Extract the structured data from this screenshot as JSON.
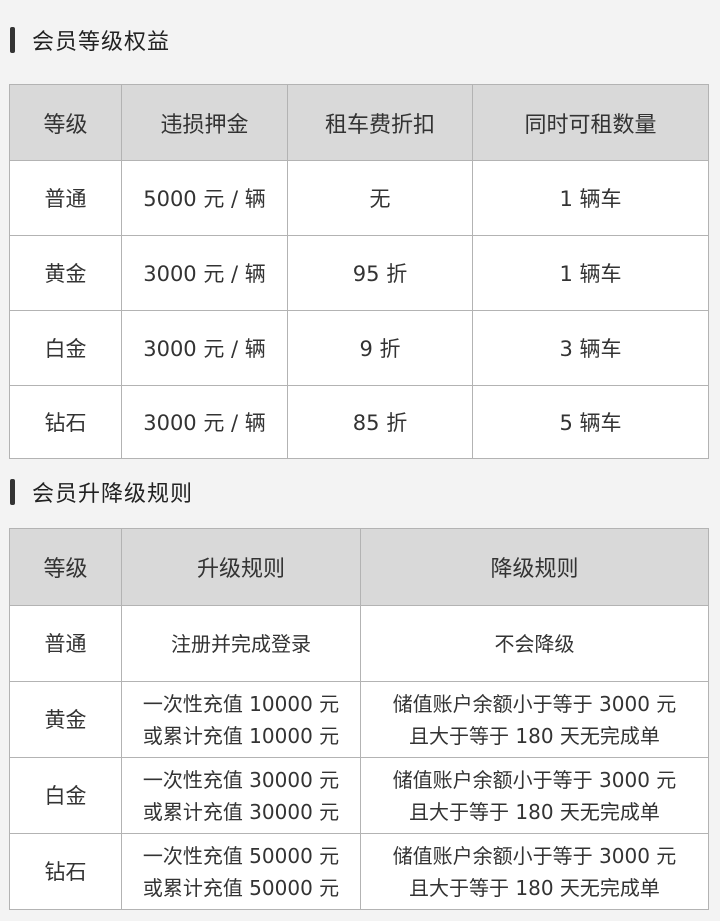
{
  "benefits": {
    "title": "会员等级权益",
    "headers": [
      "等级",
      "违损押金",
      "租车费折扣",
      "同时可租数量"
    ],
    "rows": [
      [
        "普通",
        "5000 元 / 辆",
        "无",
        "1 辆车"
      ],
      [
        "黄金",
        "3000 元 / 辆",
        "95 折",
        "1 辆车"
      ],
      [
        "白金",
        "3000 元 / 辆",
        "9 折",
        "3 辆车"
      ],
      [
        "钻石",
        "3000 元 / 辆",
        "85 折",
        "5 辆车"
      ]
    ]
  },
  "rules": {
    "title": "会员升降级规则",
    "headers": [
      "等级",
      "升级规则",
      "降级规则"
    ],
    "rows": [
      {
        "level": "普通",
        "up": [
          "注册并完成登录"
        ],
        "down": [
          "不会降级"
        ]
      },
      {
        "level": "黄金",
        "up": [
          "一次性充值 10000 元",
          "或累计充值 10000 元"
        ],
        "down": [
          "储值账户余额小于等于 3000 元",
          "且大于等于 180 天无完成单"
        ]
      },
      {
        "level": "白金",
        "up": [
          "一次性充值 30000 元",
          "或累计充值 30000 元"
        ],
        "down": [
          "储值账户余额小于等于 3000 元",
          "且大于等于 180 天无完成单"
        ]
      },
      {
        "level": "钻石",
        "up": [
          "一次性充值 50000 元",
          "或累计充值 50000 元"
        ],
        "down": [
          "储值账户余额小于等于 3000 元",
          "且大于等于 180 天无完成单"
        ]
      }
    ]
  }
}
